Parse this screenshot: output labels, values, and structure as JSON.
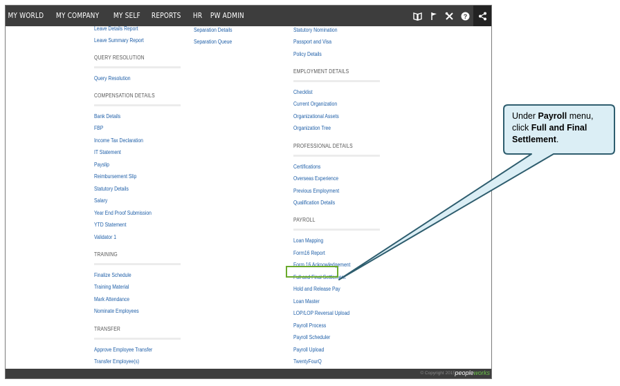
{
  "nav": {
    "items": [
      "MY WORLD",
      "MY COMPANY",
      "MY SELF",
      "REPORTS",
      "HR",
      "PW ADMIN"
    ],
    "icons": [
      "book-icon",
      "flag-icon",
      "tools-icon",
      "help-icon",
      "share-icon"
    ]
  },
  "col1": {
    "leave_links": [
      "Leave Details Report",
      "Leave Summary Report"
    ],
    "query_title": "QUERY RESOLUTION",
    "query_links": [
      "Query Resolution"
    ],
    "comp_title": "COMPENSATION DETAILS",
    "comp_links": [
      "Bank Details",
      "FBP",
      "Income Tax Declaration",
      "IT Statement",
      "Payslip",
      "Reimbursement Slip",
      "Statutory Details",
      "Salary",
      "Year End Proof Submission",
      "YTD Statement",
      "Validator 1"
    ],
    "training_title": "TRAINING",
    "training_links": [
      "Finalize Schedule",
      "Training Material",
      "Mark Attendance",
      "Nominate Employees"
    ],
    "transfer_title": "TRANSFER",
    "transfer_links": [
      "Approve Employee Transfer",
      "Transfer Employee(s)"
    ]
  },
  "col2": {
    "links": [
      "Separation Details",
      "Separation Queue"
    ]
  },
  "col3": {
    "top_links": [
      "Statutory Nomination",
      "Passport and Visa",
      "Policy Details"
    ],
    "emp_title": "EMPLOYMENT DETAILS",
    "emp_links": [
      "Checklist",
      "Current Organization",
      "Organizational Assets",
      "Organization Tree"
    ],
    "prof_title": "PROFESSIONAL DETAILS",
    "prof_links": [
      "Certifications",
      "Overseas Experience",
      "Previous Employment",
      "Qualification Details"
    ],
    "payroll_title": "PAYROLL",
    "payroll_links": [
      "Loan Mapping",
      "Form16 Report",
      "Form 16 Acknowledgement",
      "Full and Final Settlement",
      "Hold and Release Pay",
      "Loan Master",
      "LOP/LOP Reversal Upload",
      "Payroll Process",
      "Payroll Scheduler",
      "Payroll Upload",
      "TwentyFourQ"
    ]
  },
  "footer": {
    "copyright": "© Copyright 2015",
    "brand_main": "people",
    "brand_accent": "works"
  },
  "callout": {
    "part1": "Under ",
    "bold1": "Payroll",
    "part2": " menu, click ",
    "bold2": "Full and Final Settlement",
    "part3": "."
  },
  "colors": {
    "nav_bg": "#3d3d3d",
    "link": "#1f5fa8",
    "highlight": "#6aaa2c",
    "callout_fill": "#dbeef5",
    "callout_stroke": "#2e5d6e"
  }
}
